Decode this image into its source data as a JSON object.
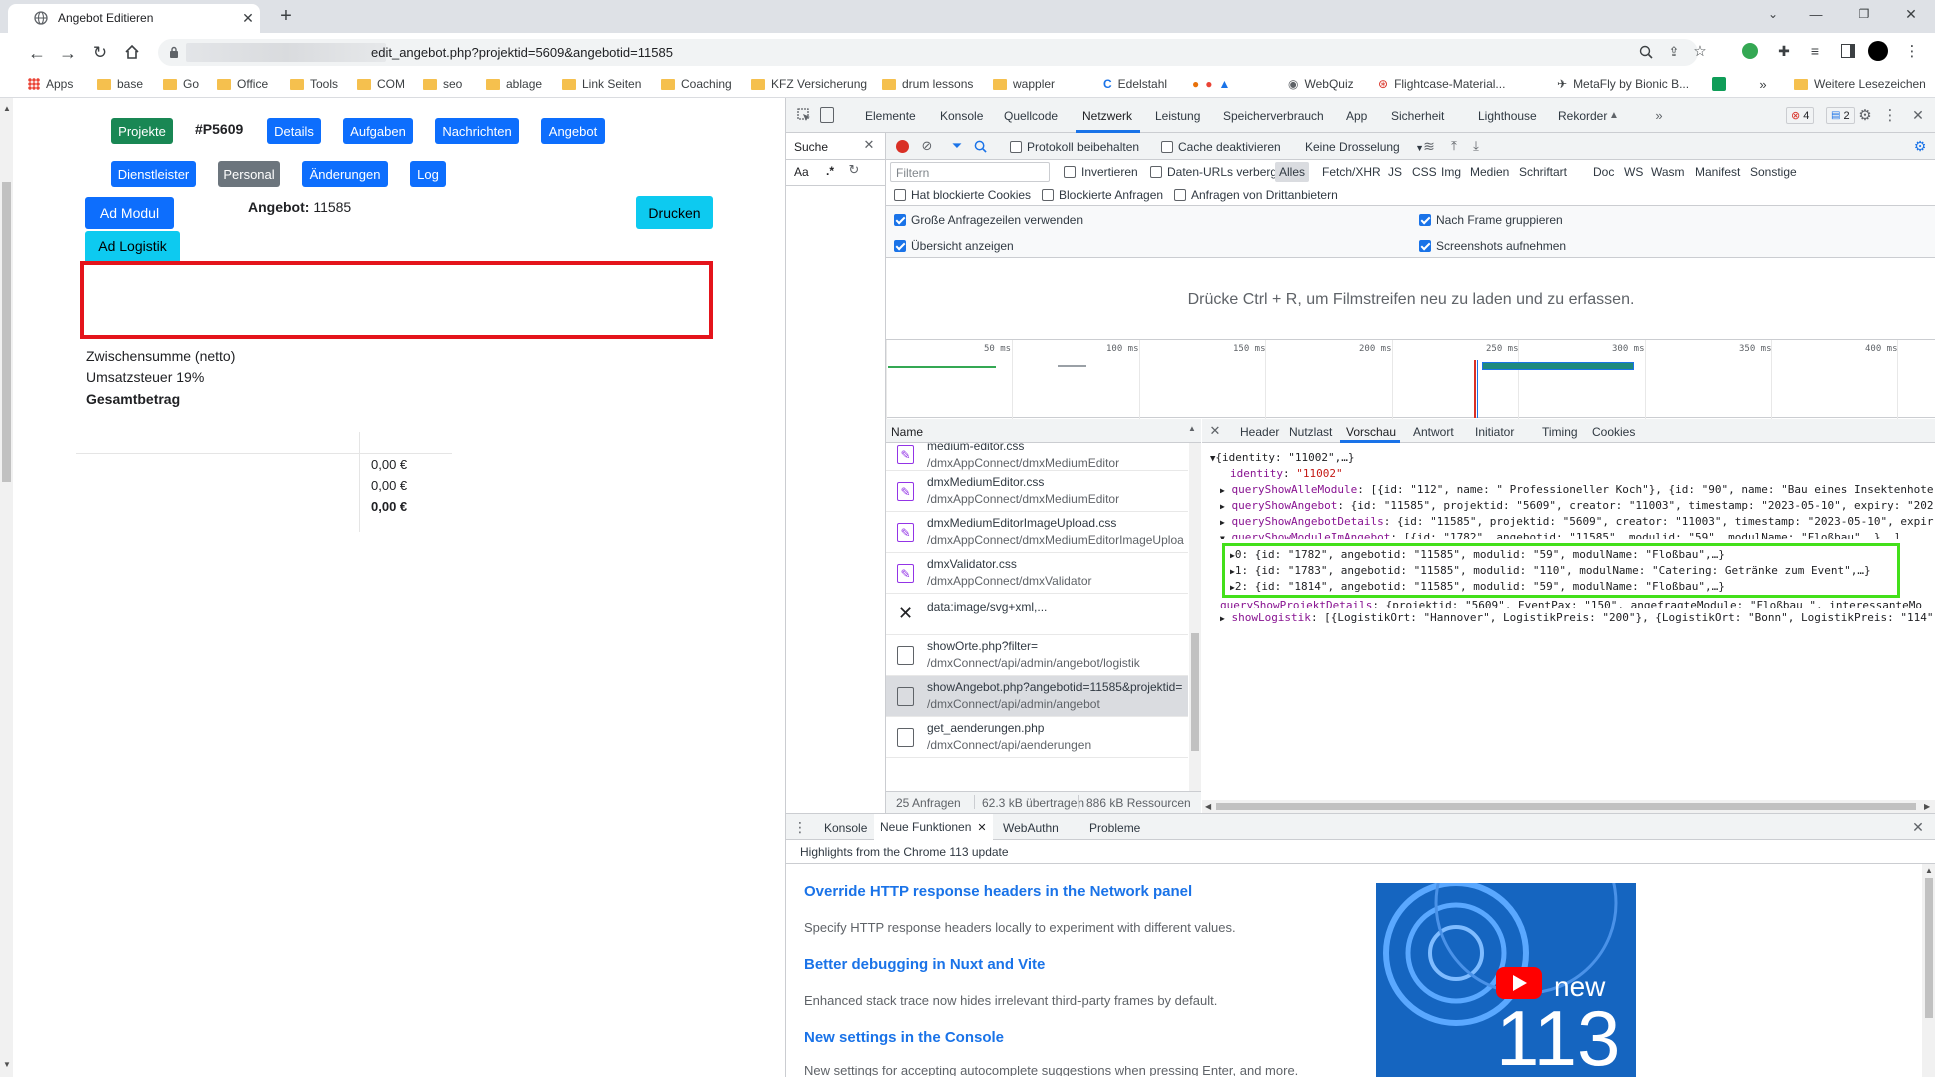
{
  "browser": {
    "tab_title": "Angebot Editieren",
    "url": "edit_angebot.php?projektid=5609&angebotid=11585",
    "bookmarks": [
      "Apps",
      "base",
      "Go",
      "Office",
      "Tools",
      "COM",
      "seo",
      "ablage",
      "Link Seiten",
      "Coaching",
      "KFZ Versicherung",
      "drum lessons",
      "wappler",
      "Edelstahl",
      "WebQuiz",
      "Flightcase-Material...",
      "MetaFly by Bionic B...",
      "Weitere Lesezeichen"
    ]
  },
  "page": {
    "btn_projekte": "Projekte",
    "project_code": "#P5609",
    "btn_details": "Details",
    "btn_aufgaben": "Aufgaben",
    "btn_nachrichten": "Nachrichten",
    "btn_angebot": "Angebot",
    "btn_dienstleister": "Dienstleister",
    "btn_personal": "Personal",
    "btn_aenderungen": "Änderungen",
    "btn_log": "Log",
    "btn_ad_modul": "Ad Modul",
    "angebot_label": "Angebot:",
    "angebot_value": "11585",
    "btn_drucken": "Drucken",
    "btn_ad_logistik": "Ad Logistik",
    "zwischensumme_label": "Zwischensumme (netto)",
    "umsatzsteuer_label": "Umsatzsteuer 19%",
    "gesamtbetrag_label": "Gesamtbetrag",
    "zwischensumme_value": "0,00 €",
    "umsatzsteuer_value": "0,00 €",
    "gesamtbetrag_value": "0,00 €"
  },
  "devtools": {
    "tabs": [
      "Elemente",
      "Konsole",
      "Quellcode",
      "Netzwerk",
      "Leistung",
      "Speicherverbrauch",
      "App",
      "Sicherheit",
      "Lighthouse",
      "Rekorder"
    ],
    "error_count": "4",
    "message_count": "2",
    "search_label": "Suche",
    "aa_label": "Aa",
    "regex_label": ".*",
    "protokoll": "Protokoll beibehalten",
    "cache": "Cache deaktivieren",
    "throttle": "Keine Drosselung",
    "filter_placeholder": "Filtern",
    "invertieren": "Invertieren",
    "daten_urls": "Daten-URLs verbergen",
    "type_filters": [
      "Alles",
      "Fetch/XHR",
      "JS",
      "CSS",
      "Img",
      "Medien",
      "Schriftart",
      "Doc",
      "WS",
      "Wasm",
      "Manifest",
      "Sonstige"
    ],
    "blocked_cookies": "Hat blockierte Cookies",
    "blocked_requests": "Blockierte Anfragen",
    "third_party": "Anfragen von Drittanbietern",
    "large_rows": "Große Anfragezeilen verwenden",
    "group_by_frame": "Nach Frame gruppieren",
    "overview": "Übersicht anzeigen",
    "screenshots": "Screenshots aufnehmen",
    "filmstrip_hint": "Drücke Ctrl + R, um Filmstreifen neu zu laden und zu erfassen.",
    "timeline_ticks": [
      "50 ms",
      "100 ms",
      "150 ms",
      "200 ms",
      "250 ms",
      "300 ms",
      "350 ms",
      "400 ms"
    ],
    "name_header": "Name",
    "requests": [
      {
        "name": "medium-editor.css",
        "path": "/dmxAppConnect/dmxMediumEditor",
        "type": "css"
      },
      {
        "name": "dmxMediumEditor.css",
        "path": "/dmxAppConnect/dmxMediumEditor",
        "type": "css"
      },
      {
        "name": "dmxMediumEditorImageUpload.css",
        "path": "/dmxAppConnect/dmxMediumEditorImageUploa",
        "type": "css"
      },
      {
        "name": "dmxValidator.css",
        "path": "/dmxAppConnect/dmxValidator",
        "type": "css"
      },
      {
        "name": "data:image/svg+xml,...",
        "path": "",
        "type": "svg"
      },
      {
        "name": "showOrte.php?filter=",
        "path": "/dmxConnect/api/admin/angebot/logistik",
        "type": "doc"
      },
      {
        "name": "showAngebot.php?angebotid=11585&projektid=",
        "path": "/dmxConnect/api/admin/angebot",
        "type": "doc"
      },
      {
        "name": "get_aenderungen.php",
        "path": "/dmxConnect/api/aenderungen",
        "type": "doc"
      }
    ],
    "status_requests": "25 Anfragen",
    "status_transferred": "62.3 kB übertragen",
    "status_resources": "886 kB Ressourcen",
    "detail_tabs": [
      "Header",
      "Nutzlast",
      "Vorschau",
      "Antwort",
      "Initiator",
      "Timing",
      "Cookies"
    ],
    "preview": {
      "root": "{identity: \"11002\",…}",
      "identity_key": "identity",
      "identity_val": "\"11002\"",
      "l1_key": "queryShowAlleModule",
      "l1_val": ": [{id: \"112\", name: \" Professioneller Koch\"}, {id: \"90\", name: \"Bau eines Insektenhote",
      "l2_key": "queryShowAngebot",
      "l2_val": ": {id: \"11585\", projektid: \"5609\", creator: \"11003\", timestamp: \"2023-05-10\", expiry: \"202",
      "l3_key": "queryShowAngebotDetails",
      "l3_val": ": {id: \"11585\", projektid: \"5609\", creator: \"11003\", timestamp: \"2023-05-10\", expir",
      "l4_key": "queryShowModuleImAngebot",
      "l4_val": ": [{id: \"1782\", angebotid: \"11585\", modulid: \"59\", modulName: \"Floßbau\",…},…]",
      "i0": "0: {id: \"1782\", angebotid: \"11585\", modulid: \"59\", modulName: \"Floßbau\",…}",
      "i1": "1: {id: \"1783\", angebotid: \"11585\", modulid: \"110\", modulName: \"Catering: Getränke zum Event\",…}",
      "i2": "2: {id: \"1814\", angebotid: \"11585\", modulid: \"59\", modulName: \"Floßbau\",…}",
      "l5_key": "queryShowProjektDetails",
      "l5_val": ": {projektid: \"5609\", EventPax: \"150\", angefragteModule: \"Floßbau \", interessanteMo",
      "l6_key": "showLogistik",
      "l6_val": ": [{LogistikOrt: \"Hannover\", LogistikPreis: \"200\"}, {LogistikOrt: \"Bonn\", LogistikPreis: \"114\""
    },
    "drawer_tabs": [
      "Konsole",
      "Neue Funktionen",
      "WebAuthn",
      "Probleme"
    ],
    "drawer_subtitle": "Highlights from the Chrome 113 update",
    "features": [
      {
        "title": "Override HTTP response headers in the Network panel",
        "desc": "Specify HTTP response headers locally to experiment with different values."
      },
      {
        "title": "Better debugging in Nuxt and Vite",
        "desc": "Enhanced stack trace now hides irrelevant third-party frames by default."
      },
      {
        "title": "New settings in the Console",
        "desc": "New settings for accepting autocomplete suggestions when pressing Enter, and more."
      }
    ],
    "promo_new": "new",
    "promo_version": "113"
  },
  "colors": {
    "primary": "#0d6efd",
    "success": "#198754",
    "secondary": "#6c757d",
    "info": "#0dcaf0",
    "red_box": "#e4141b",
    "green_box": "#43e01a"
  }
}
